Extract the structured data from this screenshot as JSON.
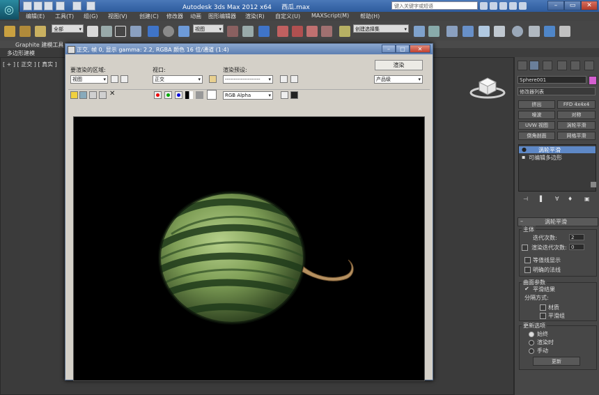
{
  "app": {
    "title": "Autodesk 3ds Max  2012 x64",
    "filename": "西瓜.max",
    "search_placeholder": "键入关键字或短语",
    "window_controls": {
      "minimize": "–",
      "maximize": "▭",
      "close": "✕"
    }
  },
  "menus": [
    "编辑(E)",
    "工具(T)",
    "组(G)",
    "视图(V)",
    "创建(C)",
    "修改器",
    "动画",
    "图形编辑器",
    "渲染(R)",
    "自定义(U)",
    "MAXScript(M)",
    "帮助(H)"
  ],
  "toolbar": {
    "selection_filter": "全部",
    "reference_coord": "视图",
    "named_selection": "创建选择集"
  },
  "ribbon": {
    "tab": "Graphite 建模工具",
    "sub": "多边形建模"
  },
  "viewport": {
    "label": "[ + ] [ 正交 ] [ 真实 ]"
  },
  "render_window": {
    "title": "正交, 帧 0, 显示 gamma: 2.2, RGBA 颜色 16 位/通道 (1:4)",
    "controls": {
      "minimize": "–",
      "maximize": "□",
      "close": "✕"
    },
    "area_label": "要渲染的区域:",
    "area_value": "视图",
    "viewport_label": "视口:",
    "viewport_value": "正交",
    "preset_label": "渲染预设:",
    "preset_value": "--------------------",
    "render_button": "渲染",
    "quality_value": "产品级",
    "channel_value": "RGB Alpha",
    "clear_icon": "✕"
  },
  "command_panel": {
    "object_name": "Sphere001",
    "object_color": "#d55fd0",
    "modifier_list": "修改器列表",
    "modifier_buttons": [
      [
        "挤出",
        "FFD 4x4x4"
      ],
      [
        "噪波",
        "对称"
      ],
      [
        "UVW 视图",
        "涡轮平滑"
      ],
      [
        "倒角剖面",
        "网格平滑"
      ]
    ],
    "stack": [
      {
        "label": "涡轮平滑",
        "selected": true
      },
      {
        "label": "可编辑多边形",
        "selected": false
      }
    ],
    "rollout_title": "涡轮平滑",
    "main_group": "主体",
    "iterations_label": "迭代次数:",
    "iterations_value": "2",
    "render_iters_label": "渲染迭代次数:",
    "render_iters_value": "0",
    "isoline_label": "等值线显示",
    "explicit_normals_label": "明确的法线",
    "surface_group": "曲面参数",
    "smooth_result_label": "平滑结果",
    "separate_label": "分隔方式:",
    "materials_label": "材质",
    "smoothing_groups_label": "平滑组",
    "update_group": "更新选项",
    "update_options": [
      {
        "label": "始终",
        "selected": true
      },
      {
        "label": "渲染时",
        "selected": false
      },
      {
        "label": "手动",
        "selected": false
      }
    ],
    "update_button": "更新"
  }
}
